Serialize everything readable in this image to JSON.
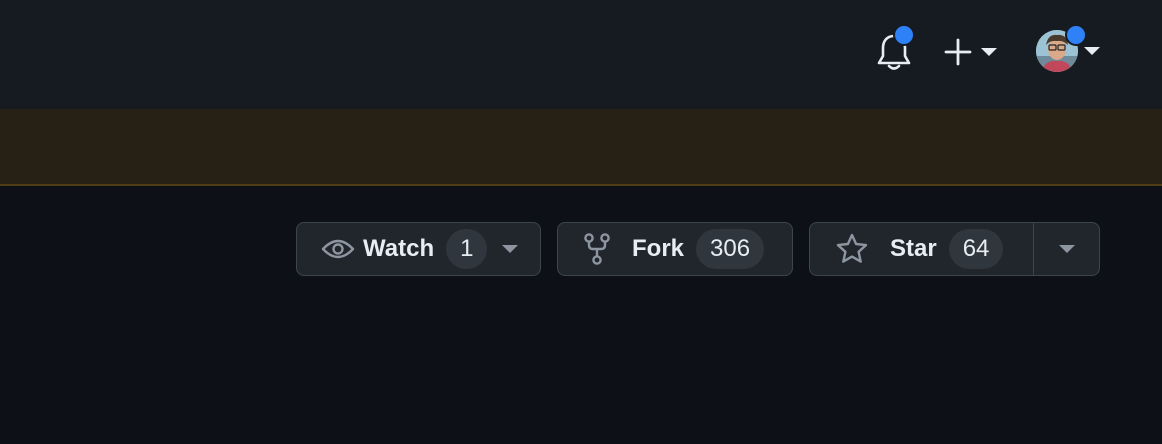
{
  "header": {
    "notifications": {
      "icon": "bell-icon",
      "has_unread": true
    },
    "create": {
      "icon": "plus-icon"
    },
    "user": {
      "icon": "avatar",
      "has_status": true
    }
  },
  "repo_actions": {
    "watch": {
      "label": "Watch",
      "count": "1",
      "icon": "eye-icon"
    },
    "fork": {
      "label": "Fork",
      "count": "306",
      "icon": "repo-forked-icon"
    },
    "star": {
      "label": "Star",
      "count": "64",
      "icon": "star-icon"
    }
  },
  "colors": {
    "header_bg": "#161b22",
    "banner_bg": "#272115",
    "page_bg": "#0d1117",
    "accent_dot": "#2f81f7",
    "button_bg": "#21262d"
  }
}
